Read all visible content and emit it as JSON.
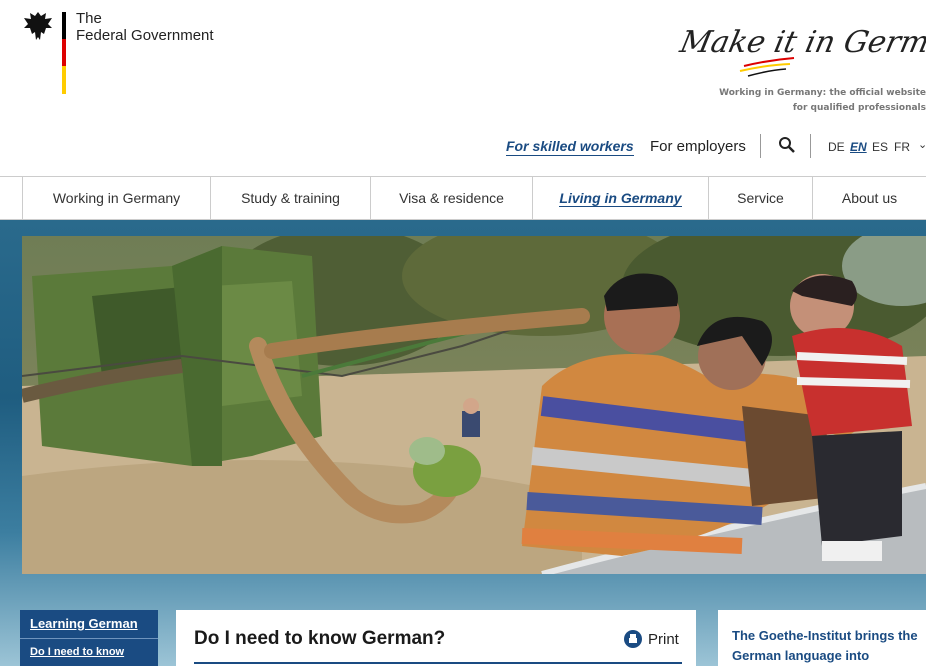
{
  "header": {
    "gov_line1": "The",
    "gov_line2": "Federal Government",
    "brand_script": "Make it in Germany",
    "brand_sub_line1": "Working in Germany: the official website",
    "brand_sub_line2": "for qualified professionals"
  },
  "topnav": {
    "skilled_workers": "For skilled workers",
    "employers": "For employers",
    "languages": [
      "DE",
      "EN",
      "ES",
      "FR"
    ],
    "active_language": "EN"
  },
  "mainnav": {
    "items": [
      "Working in Germany",
      "Study & training",
      "Visa & residence",
      "Living in Germany",
      "Service",
      "About us"
    ],
    "active": "Living in Germany"
  },
  "sidenav": {
    "section": "Learning German",
    "link": "Do I need to know"
  },
  "content": {
    "title": "Do I need to know German?",
    "print_label": "Print"
  },
  "goethe": {
    "text": "The Goethe-Institut brings the German language into"
  },
  "colors": {
    "brand_blue": "#1a4b82",
    "flag_black": "#000000",
    "flag_red": "#dd0000",
    "flag_gold": "#ffcc00"
  }
}
